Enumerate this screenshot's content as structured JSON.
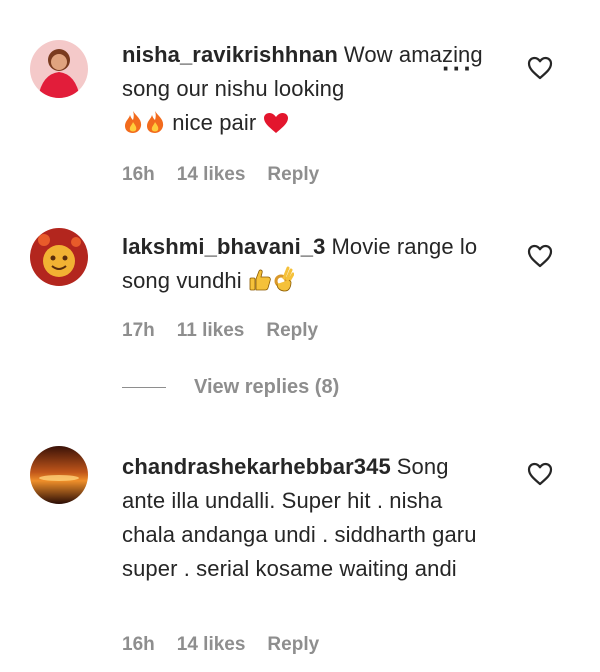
{
  "comments": [
    {
      "username": "nisha_ravikrishhnan",
      "text": "Wow amazing song our nishu looking",
      "text_after_emoji": "nice pair",
      "emojis": [
        "fire-emoji",
        "fire-emoji",
        "red-heart-emoji"
      ],
      "time": "16h",
      "likes": "14 likes",
      "reply": "Reply"
    },
    {
      "username": "lakshmi_bhavani_3",
      "text": "Movie range lo song vundhi",
      "emojis": [
        "thumbs-up-emoji",
        "ok-hand-emoji"
      ],
      "time": "17h",
      "likes": "11 likes",
      "reply": "Reply",
      "view_replies": "View replies (8)"
    },
    {
      "username": "chandrashekarhebbar345",
      "text": "Song ante illa undalli. Super hit . nisha chala andanga undi . siddharth garu super . serial kosame waiting andi",
      "time": "16h",
      "likes": "14 likes",
      "reply": "Reply"
    }
  ],
  "icons": {
    "like": "heart-outline-icon",
    "more": "more-options-icon"
  }
}
